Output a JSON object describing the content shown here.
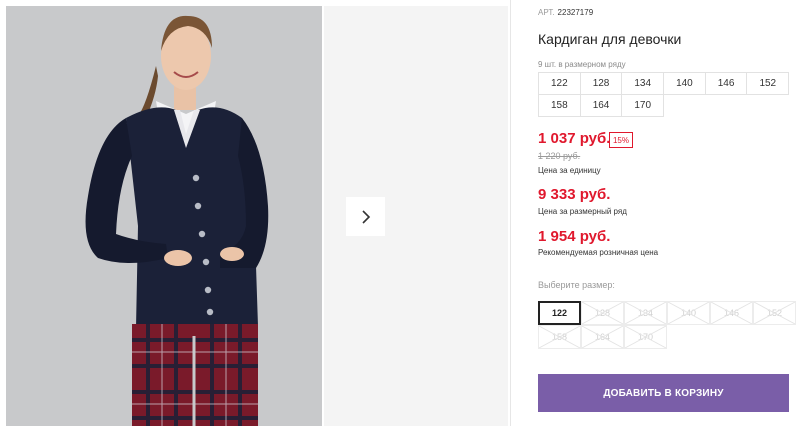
{
  "product": {
    "art_label": "АРТ.",
    "art_number": "22327179",
    "title": "Кардиган для девочки",
    "row_info": "9 шт. в размерном ряду",
    "row_sizes": [
      [
        "122",
        "128",
        "134",
        "140",
        "146",
        "152"
      ],
      [
        "158",
        "164",
        "170"
      ]
    ]
  },
  "pricing": {
    "unit_price": "1 037 руб.",
    "discount": "15%",
    "old_price": "1 220 руб.",
    "unit_caption": "Цена за единицу",
    "row_price": "9 333 руб.",
    "row_caption": "Цена за размерный ряд",
    "retail_price": "1 954 руб.",
    "retail_caption": "Рекомендуемая розничная цена",
    "accent_color": "#e0182d"
  },
  "size_picker": {
    "label": "Выберите размер:",
    "rows": [
      [
        "122",
        "128",
        "134",
        "140",
        "146",
        "152"
      ],
      [
        "158",
        "164",
        "170"
      ]
    ],
    "selected": "122"
  },
  "cart": {
    "button_label": "ДОБАВИТЬ В КОРЗИНУ",
    "button_color": "#7a5ea8"
  },
  "gallery": {
    "next_icon": "chevron-right-icon"
  }
}
